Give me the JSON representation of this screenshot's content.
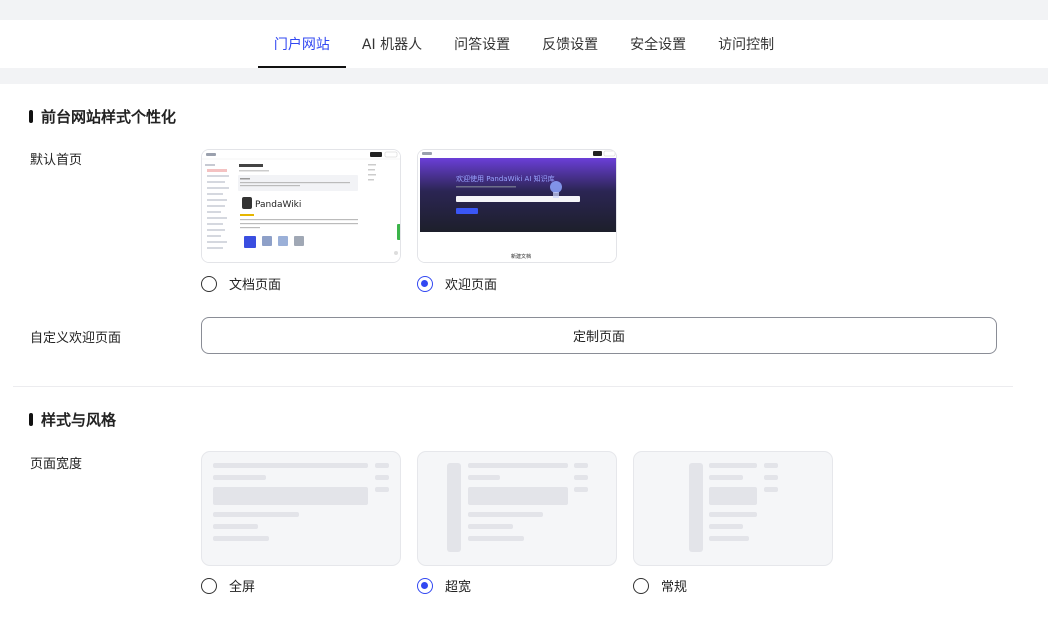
{
  "tabs": [
    {
      "label": "门户网站",
      "active": true
    },
    {
      "label": "AI 机器人",
      "active": false
    },
    {
      "label": "问答设置",
      "active": false
    },
    {
      "label": "反馈设置",
      "active": false
    },
    {
      "label": "安全设置",
      "active": false
    },
    {
      "label": "访问控制",
      "active": false
    }
  ],
  "section1": {
    "title": "前台网站样式个性化",
    "default_home_label": "默认首页",
    "options": [
      {
        "label": "文档页面",
        "selected": false
      },
      {
        "label": "欢迎页面",
        "selected": true
      }
    ],
    "thumb_doc": {
      "logo_text": "PandaWiki",
      "header_text": "PandaWiki 介绍"
    },
    "thumb_welcome": {
      "hero_text": "欢迎使用 PandaWiki AI 知识库",
      "footer_text": "新建文档"
    },
    "custom_welcome_label": "自定义欢迎页面",
    "custom_button": "定制页面"
  },
  "section2": {
    "title": "样式与风格",
    "page_width_label": "页面宽度",
    "options": [
      {
        "label": "全屏",
        "selected": false
      },
      {
        "label": "超宽",
        "selected": true
      },
      {
        "label": "常规",
        "selected": false
      }
    ]
  },
  "colors": {
    "accent": "#3248f2",
    "background": "#f2f3f5",
    "border": "#e3e4e8"
  }
}
